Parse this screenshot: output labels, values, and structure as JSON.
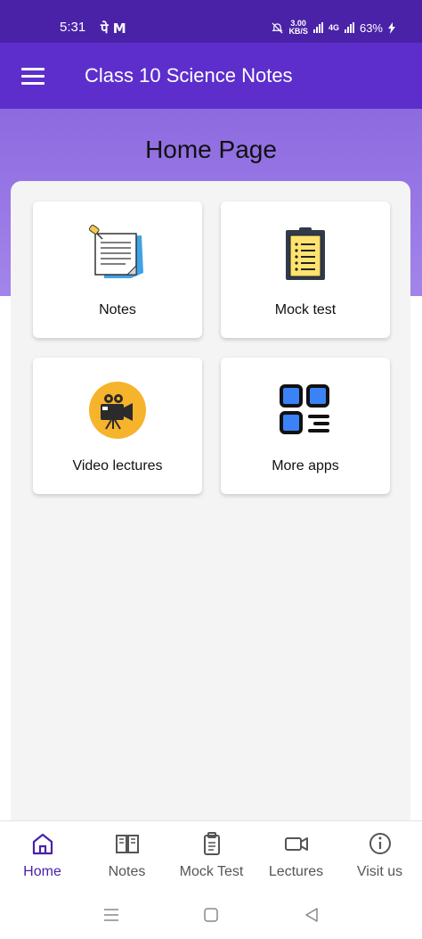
{
  "status_bar": {
    "time": "5:31",
    "extra_icons": "पे M",
    "speed_value": "3.00",
    "speed_unit": "KB/S",
    "network_type": "4G",
    "battery": "63%"
  },
  "app_bar": {
    "title": "Class 10 Science Notes",
    "menu_icon": "hamburger-menu-icon"
  },
  "page": {
    "heading": "Home Page"
  },
  "cards": [
    {
      "label": "Notes",
      "icon": "notes-icon"
    },
    {
      "label": "Mock test",
      "icon": "clipboard-icon"
    },
    {
      "label": "Video lectures",
      "icon": "video-camera-icon"
    },
    {
      "label": "More apps",
      "icon": "apps-grid-icon"
    }
  ],
  "bottom_nav": [
    {
      "label": "Home",
      "icon": "home-icon",
      "active": true
    },
    {
      "label": "Notes",
      "icon": "book-icon",
      "active": false
    },
    {
      "label": "Mock Test",
      "icon": "clipboard-icon",
      "active": false
    },
    {
      "label": "Lectures",
      "icon": "video-icon",
      "active": false
    },
    {
      "label": "Visit us",
      "icon": "info-icon",
      "active": false
    }
  ],
  "colors": {
    "status_bar": "#4a22a7",
    "app_bar": "#5d2ecc",
    "hero": "#8e6ae0",
    "active_nav": "#4a22a7",
    "panel": "#f4f4f5"
  }
}
